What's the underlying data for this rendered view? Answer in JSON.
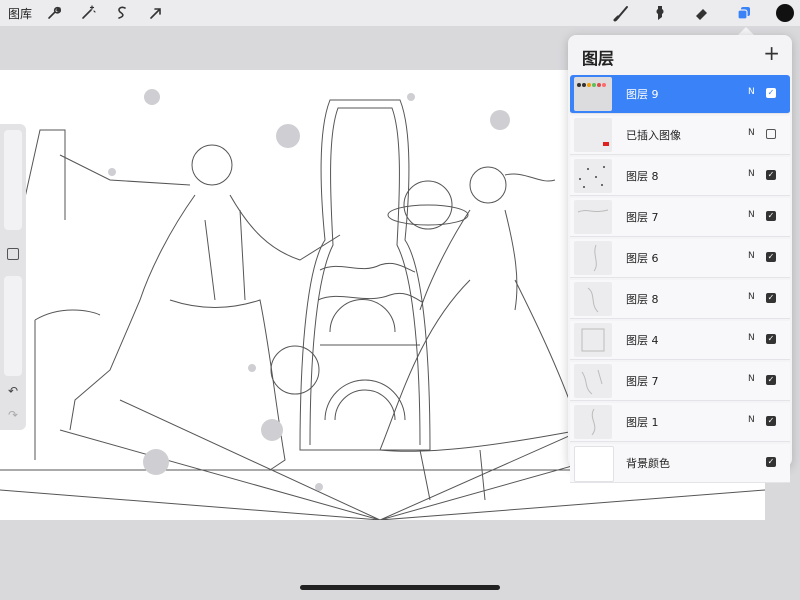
{
  "toolbar": {
    "gallery_label": "图库",
    "left_icons": [
      "wrench-icon",
      "magic-wand-icon",
      "selection-icon",
      "move-arrow-icon"
    ],
    "right_icons": [
      "brush-icon",
      "smudge-icon",
      "eraser-icon",
      "layers-icon"
    ],
    "active_color": "#111111"
  },
  "layers_panel": {
    "title": "图层",
    "add_label": "+",
    "layers": [
      {
        "name": "图层 9",
        "mode": "N",
        "visible": true,
        "active": true
      },
      {
        "name": "已插入图像",
        "mode": "N",
        "visible": false,
        "active": false
      },
      {
        "name": "图层 8",
        "mode": "N",
        "visible": true,
        "active": false
      },
      {
        "name": "图层 7",
        "mode": "N",
        "visible": true,
        "active": false
      },
      {
        "name": "图层 6",
        "mode": "N",
        "visible": true,
        "active": false
      },
      {
        "name": "图层 8",
        "mode": "N",
        "visible": true,
        "active": false
      },
      {
        "name": "图层 4",
        "mode": "N",
        "visible": true,
        "active": false
      },
      {
        "name": "图层 7",
        "mode": "N",
        "visible": true,
        "active": false
      },
      {
        "name": "图层 1",
        "mode": "N",
        "visible": true,
        "active": false
      },
      {
        "name": "背景颜色",
        "mode": "",
        "visible": true,
        "active": false
      }
    ]
  },
  "accent_color": "#3a82f7"
}
